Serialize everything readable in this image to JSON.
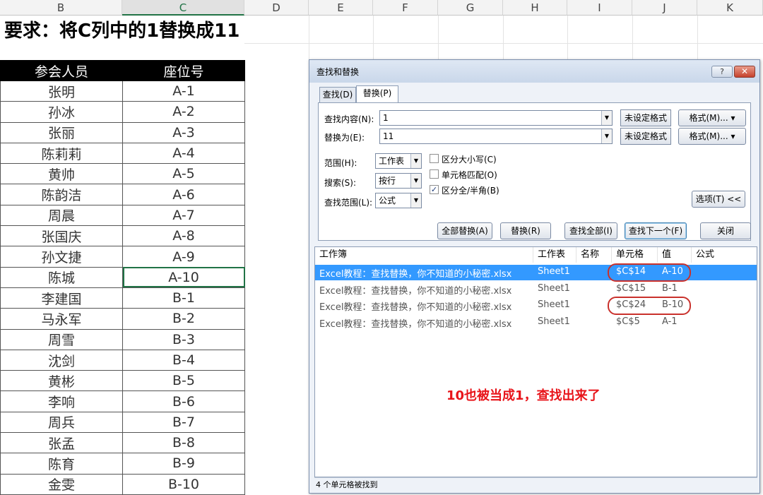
{
  "sheet": {
    "columns": [
      "B",
      "C",
      "D",
      "E",
      "F",
      "G",
      "H",
      "I",
      "J",
      "K"
    ],
    "requirement": "要求：将C列中的1替换成11",
    "table": {
      "headers": [
        "参会人员",
        "座位号"
      ],
      "rows": [
        [
          "张明",
          "A-1"
        ],
        [
          "孙冰",
          "A-2"
        ],
        [
          "张丽",
          "A-3"
        ],
        [
          "陈莉莉",
          "A-4"
        ],
        [
          "黄帅",
          "A-5"
        ],
        [
          "陈韵洁",
          "A-6"
        ],
        [
          "周晨",
          "A-7"
        ],
        [
          "张国庆",
          "A-8"
        ],
        [
          "孙文捷",
          "A-9"
        ],
        [
          "陈城",
          "A-10"
        ],
        [
          "李建国",
          "B-1"
        ],
        [
          "马永军",
          "B-2"
        ],
        [
          "周雪",
          "B-3"
        ],
        [
          "沈剑",
          "B-4"
        ],
        [
          "黄彬",
          "B-5"
        ],
        [
          "李响",
          "B-6"
        ],
        [
          "周兵",
          "B-7"
        ],
        [
          "张孟",
          "B-8"
        ],
        [
          "陈育",
          "B-9"
        ],
        [
          "金雯",
          "B-10"
        ]
      ]
    }
  },
  "dialog": {
    "title": "查找和替换",
    "help_label": "?",
    "close_label": "✕",
    "tabs": [
      "查找(D)",
      "替换(P)"
    ],
    "find_label": "查找内容(N):",
    "find_value": "1",
    "replace_label": "替换为(E):",
    "replace_value": "11",
    "format_status_1": "未设定格式",
    "format_status_2": "未设定格式",
    "format_button": "格式(M)...",
    "scope_label": "范围(H):",
    "scope_value": "工作表",
    "search_label": "搜索(S):",
    "search_value": "按行",
    "lookin_label": "查找范围(L):",
    "lookin_value": "公式",
    "opt_case": "区分大小写(C)",
    "opt_cell": "单元格匹配(O)",
    "opt_width": "区分全/半角(B)",
    "options_button": "选项(T) <<",
    "btn_replace_all": "全部替换(A)",
    "btn_replace": "替换(R)",
    "btn_find_all": "查找全部(I)",
    "btn_find_next": "查找下一个(F)",
    "btn_close": "关闭",
    "result_headers": [
      "工作簿",
      "工作表",
      "名称",
      "单元格",
      "值",
      "公式"
    ],
    "results": [
      {
        "book": "Excel教程：查找替换，你不知道的小秘密.xlsx",
        "sheet": "Sheet1",
        "cell": "$C$14",
        "value": "A-10"
      },
      {
        "book": "Excel教程：查找替换，你不知道的小秘密.xlsx",
        "sheet": "Sheet1",
        "cell": "$C$15",
        "value": "B-1"
      },
      {
        "book": "Excel教程：查找替换，你不知道的小秘密.xlsx",
        "sheet": "Sheet1",
        "cell": "$C$24",
        "value": "B-10"
      },
      {
        "book": "Excel教程：查找替换，你不知道的小秘密.xlsx",
        "sheet": "Sheet1",
        "cell": "$C$5",
        "value": "A-1"
      }
    ],
    "annotation": "10也被当成1，查找出来了",
    "status": "4 个单元格被找到"
  }
}
